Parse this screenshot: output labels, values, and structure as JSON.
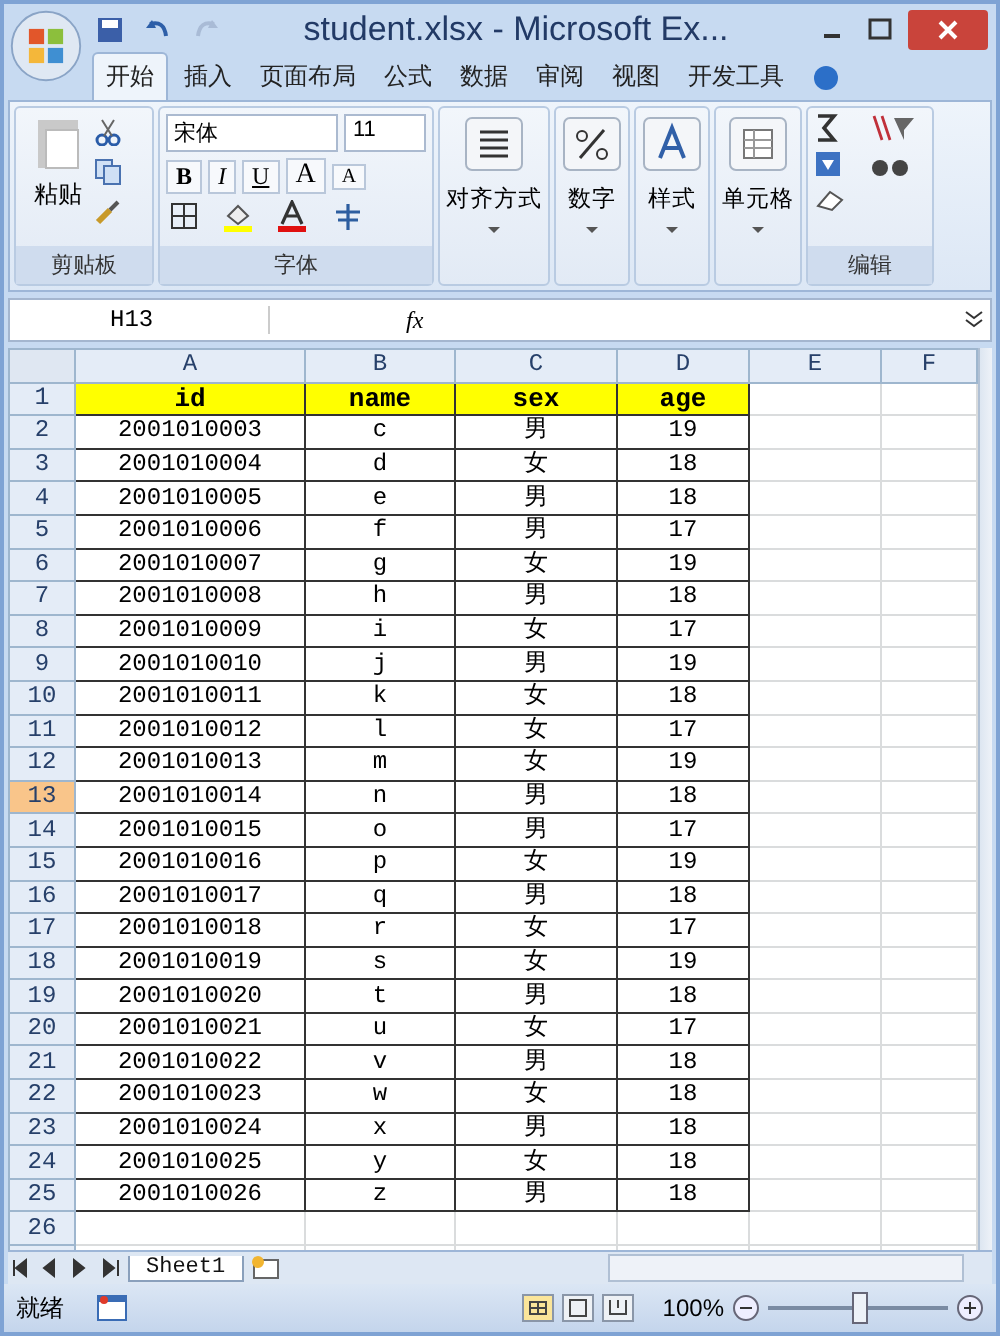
{
  "window": {
    "title": "student.xlsx - Microsoft Ex..."
  },
  "tabs": [
    {
      "label": "开始",
      "selected": true
    },
    {
      "label": "插入",
      "selected": false
    },
    {
      "label": "页面布局",
      "selected": false
    },
    {
      "label": "公式",
      "selected": false
    },
    {
      "label": "数据",
      "selected": false
    },
    {
      "label": "审阅",
      "selected": false
    },
    {
      "label": "视图",
      "selected": false
    },
    {
      "label": "开发工具",
      "selected": false
    }
  ],
  "ribbon": {
    "clipboard": {
      "label": "剪贴板",
      "paste": "粘贴"
    },
    "font": {
      "label": "字体",
      "font_name": "宋体",
      "font_size": "11",
      "bold": "B",
      "italic": "I",
      "underline": "U",
      "grow": "A",
      "shrink": "A"
    },
    "alignment": "对齐方式",
    "number": "数字",
    "styles": "样式",
    "cells": "单元格",
    "editing": "编辑"
  },
  "formula_bar": {
    "name_box": "H13",
    "function_label": "fx"
  },
  "columns": [
    {
      "label": "A",
      "selected": false
    },
    {
      "label": "B",
      "selected": false
    },
    {
      "label": "C",
      "selected": false
    },
    {
      "label": "D",
      "selected": false
    },
    {
      "label": "E",
      "selected": false
    },
    {
      "label": "F",
      "selected": false
    }
  ],
  "rows": [
    {
      "number": "1",
      "selected": false,
      "kind": "header",
      "cells": [
        "id",
        "name",
        "sex",
        "age"
      ]
    },
    {
      "number": "2",
      "selected": false,
      "kind": "data",
      "cells": [
        "2001010003",
        "c",
        "男",
        "19"
      ]
    },
    {
      "number": "3",
      "selected": false,
      "kind": "data",
      "cells": [
        "2001010004",
        "d",
        "女",
        "18"
      ]
    },
    {
      "number": "4",
      "selected": false,
      "kind": "data",
      "cells": [
        "2001010005",
        "e",
        "男",
        "18"
      ]
    },
    {
      "number": "5",
      "selected": false,
      "kind": "data",
      "cells": [
        "2001010006",
        "f",
        "男",
        "17"
      ]
    },
    {
      "number": "6",
      "selected": false,
      "kind": "data",
      "cells": [
        "2001010007",
        "g",
        "女",
        "19"
      ]
    },
    {
      "number": "7",
      "selected": false,
      "kind": "data",
      "cells": [
        "2001010008",
        "h",
        "男",
        "18"
      ]
    },
    {
      "number": "8",
      "selected": false,
      "kind": "data",
      "cells": [
        "2001010009",
        "i",
        "女",
        "17"
      ]
    },
    {
      "number": "9",
      "selected": false,
      "kind": "data",
      "cells": [
        "2001010010",
        "j",
        "男",
        "19"
      ]
    },
    {
      "number": "10",
      "selected": false,
      "kind": "data",
      "cells": [
        "2001010011",
        "k",
        "女",
        "18"
      ]
    },
    {
      "number": "11",
      "selected": false,
      "kind": "data",
      "cells": [
        "2001010012",
        "l",
        "女",
        "17"
      ]
    },
    {
      "number": "12",
      "selected": false,
      "kind": "data",
      "cells": [
        "2001010013",
        "m",
        "女",
        "19"
      ]
    },
    {
      "number": "13",
      "selected": true,
      "kind": "data",
      "cells": [
        "2001010014",
        "n",
        "男",
        "18"
      ]
    },
    {
      "number": "14",
      "selected": false,
      "kind": "data",
      "cells": [
        "2001010015",
        "o",
        "男",
        "17"
      ]
    },
    {
      "number": "15",
      "selected": false,
      "kind": "data",
      "cells": [
        "2001010016",
        "p",
        "女",
        "19"
      ]
    },
    {
      "number": "16",
      "selected": false,
      "kind": "data",
      "cells": [
        "2001010017",
        "q",
        "男",
        "18"
      ]
    },
    {
      "number": "17",
      "selected": false,
      "kind": "data",
      "cells": [
        "2001010018",
        "r",
        "女",
        "17"
      ]
    },
    {
      "number": "18",
      "selected": false,
      "kind": "data",
      "cells": [
        "2001010019",
        "s",
        "女",
        "19"
      ]
    },
    {
      "number": "19",
      "selected": false,
      "kind": "data",
      "cells": [
        "2001010020",
        "t",
        "男",
        "18"
      ]
    },
    {
      "number": "20",
      "selected": false,
      "kind": "data",
      "cells": [
        "2001010021",
        "u",
        "女",
        "17"
      ]
    },
    {
      "number": "21",
      "selected": false,
      "kind": "data",
      "cells": [
        "2001010022",
        "v",
        "男",
        "18"
      ]
    },
    {
      "number": "22",
      "selected": false,
      "kind": "data",
      "cells": [
        "2001010023",
        "w",
        "女",
        "18"
      ]
    },
    {
      "number": "23",
      "selected": false,
      "kind": "data",
      "cells": [
        "2001010024",
        "x",
        "男",
        "18"
      ]
    },
    {
      "number": "24",
      "selected": false,
      "kind": "data",
      "cells": [
        "2001010025",
        "y",
        "女",
        "18"
      ]
    },
    {
      "number": "25",
      "selected": false,
      "kind": "data",
      "cells": [
        "2001010026",
        "z",
        "男",
        "18"
      ]
    },
    {
      "number": "26",
      "selected": false,
      "kind": "data",
      "cells": []
    }
  ],
  "sheet_tabs": [
    {
      "label": "Sheet1",
      "selected": true
    }
  ],
  "status_bar": {
    "status": "就绪",
    "zoom": "100%",
    "view_modes": [
      {
        "selected": true
      },
      {
        "selected": false
      },
      {
        "selected": false
      }
    ],
    "zoom_slider": {
      "level": 0.5
    }
  }
}
